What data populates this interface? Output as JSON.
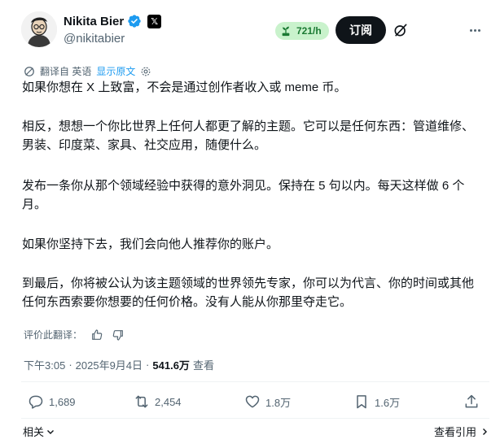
{
  "author": {
    "display_name": "Nikita Bier",
    "handle": "@nikitabier",
    "x_badge": "𝕏"
  },
  "header": {
    "growth_label": "721/h",
    "subscribe_label": "订阅"
  },
  "translation": {
    "translated_from": "翻译自 英语",
    "show_original": "显示原文"
  },
  "post": {
    "paragraphs": [
      "如果你想在 X 上致富，不会是通过创作者收入或 meme 币。",
      "相反，想想一个你比世界上任何人都更了解的主题。它可以是任何东西：管道维修、男装、印度菜、家具、社交应用，随便什么。",
      "发布一条你从那个领域经验中获得的意外洞见。保持在 5 句以内。每天这样做 6 个月。",
      "如果你坚持下去，我们会向他人推荐你的账户。",
      "到最后，你将被公认为该主题领域的世界领先专家，你可以为代言、你的时间或其他任何东西索要你想要的任何价格。没有人能从你那里夺走它。"
    ]
  },
  "rating": {
    "label": "评价此翻译："
  },
  "meta": {
    "time": "下午3:05",
    "separator": "·",
    "date": "2025年9月4日",
    "views_count": "541.6万",
    "views_label": "查看"
  },
  "actions": {
    "replies": "1,689",
    "reposts": "2,454",
    "likes": "1.8万",
    "bookmarks": "1.6万"
  },
  "footer": {
    "related_label": "相关",
    "quotes_label": "查看引用"
  },
  "colors": {
    "text": "#0f1419",
    "secondary": "#536471",
    "link": "#1d9bf0",
    "verified": "#1d9bf0",
    "growth_bg": "#c9f2cc",
    "growth_text": "#1b7a33"
  }
}
